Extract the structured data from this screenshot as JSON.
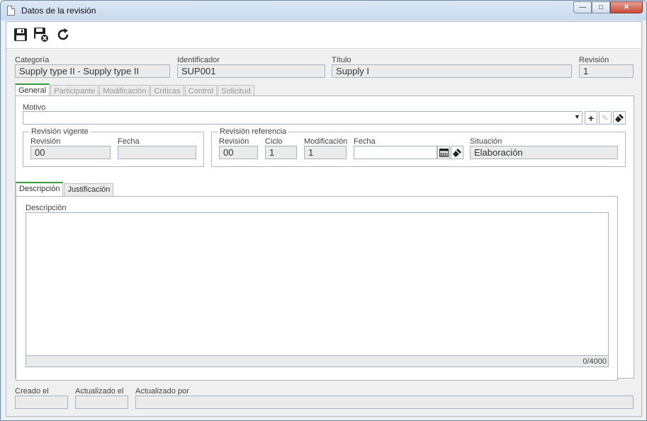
{
  "window": {
    "title": "Datos de la revisión"
  },
  "toolbar": {
    "save": "save-icon",
    "save_close": "save-close-icon",
    "refresh": "refresh-icon"
  },
  "header": {
    "categoria_label": "Categoría",
    "categoria_value": "Supply type II - Supply type II",
    "identificador_label": "Identificador",
    "identificador_value": "SUP001",
    "titulo_label": "Título",
    "titulo_value": "Supply I",
    "revision_label": "Revisión",
    "revision_value": "1"
  },
  "tabs": [
    {
      "label": "General",
      "active": true
    },
    {
      "label": "Participante",
      "active": false
    },
    {
      "label": "Modificación",
      "active": false
    },
    {
      "label": "Críticas",
      "active": false
    },
    {
      "label": "Control",
      "active": false
    },
    {
      "label": "Solicitud",
      "active": false
    }
  ],
  "general": {
    "motivo_label": "Motivo",
    "motivo_value": "",
    "vigente": {
      "title": "Revisión vigente",
      "revision_label": "Revisión",
      "revision_value": "00",
      "fecha_label": "Fecha",
      "fecha_value": ""
    },
    "referencia": {
      "title": "Revisión referencia",
      "revision_label": "Revisión",
      "revision_value": "00",
      "ciclo_label": "Ciclo",
      "ciclo_value": "1",
      "modificacion_label": "Modificación",
      "modificacion_value": "1",
      "fecha_label": "Fecha",
      "fecha_value": "",
      "situacion_label": "Situación",
      "situacion_value": "Elaboración"
    },
    "subtabs": [
      {
        "label": "Descripción",
        "active": true
      },
      {
        "label": "Justificación",
        "active": false
      }
    ],
    "descripcion_label": "Descripción",
    "descripcion_value": "",
    "counter": "0/4000"
  },
  "footer": {
    "creado_label": "Creado el",
    "creado_value": "",
    "actualizado_label": "Actualizado el",
    "actualizado_value": "",
    "actualizado_por_label": "Actualizado por",
    "actualizado_por_value": ""
  }
}
